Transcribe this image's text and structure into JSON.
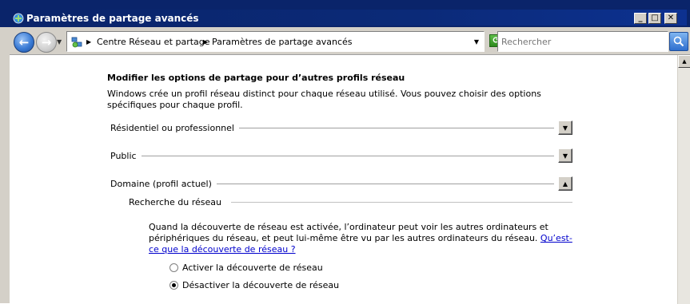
{
  "window": {
    "title": "Paramètres de partage avancés",
    "buttons": {
      "minimize": "_",
      "maximize": "□",
      "close": "✕"
    }
  },
  "nav": {
    "back_icon": "back-arrow-icon",
    "forward_icon": "forward-arrow-icon",
    "breadcrumb": [
      "Centre Réseau et partage",
      "Paramètres de partage avancés"
    ],
    "search_placeholder": "Rechercher"
  },
  "content": {
    "heading": "Modifier les options de partage pour d’autres profils réseau",
    "description": "Windows crée un profil réseau distinct pour chaque réseau utilisé. Vous pouvez choisir des options spécifiques pour chaque profil.",
    "profiles": [
      {
        "label": "Résidentiel ou professionnel",
        "expanded": false
      },
      {
        "label": "Public",
        "expanded": false
      },
      {
        "label": "Domaine (profil actuel)",
        "expanded": true
      }
    ],
    "subsection": {
      "title": "Recherche du réseau",
      "text": "Quand la découverte de réseau est activée, l’ordinateur peut voir les autres ordinateurs et périphériques du réseau, et peut lui-même être vu par les autres ordinateurs du réseau. ",
      "link": "Qu’est-ce que la découverte de réseau ?",
      "options": [
        {
          "label": "Activer la découverte de réseau",
          "selected": false
        },
        {
          "label": "Désactiver la découverte de réseau",
          "selected": true
        }
      ]
    }
  },
  "colors": {
    "titlebar": "#0a246a",
    "chrome": "#d4d0c8",
    "link": "#0000cc"
  }
}
